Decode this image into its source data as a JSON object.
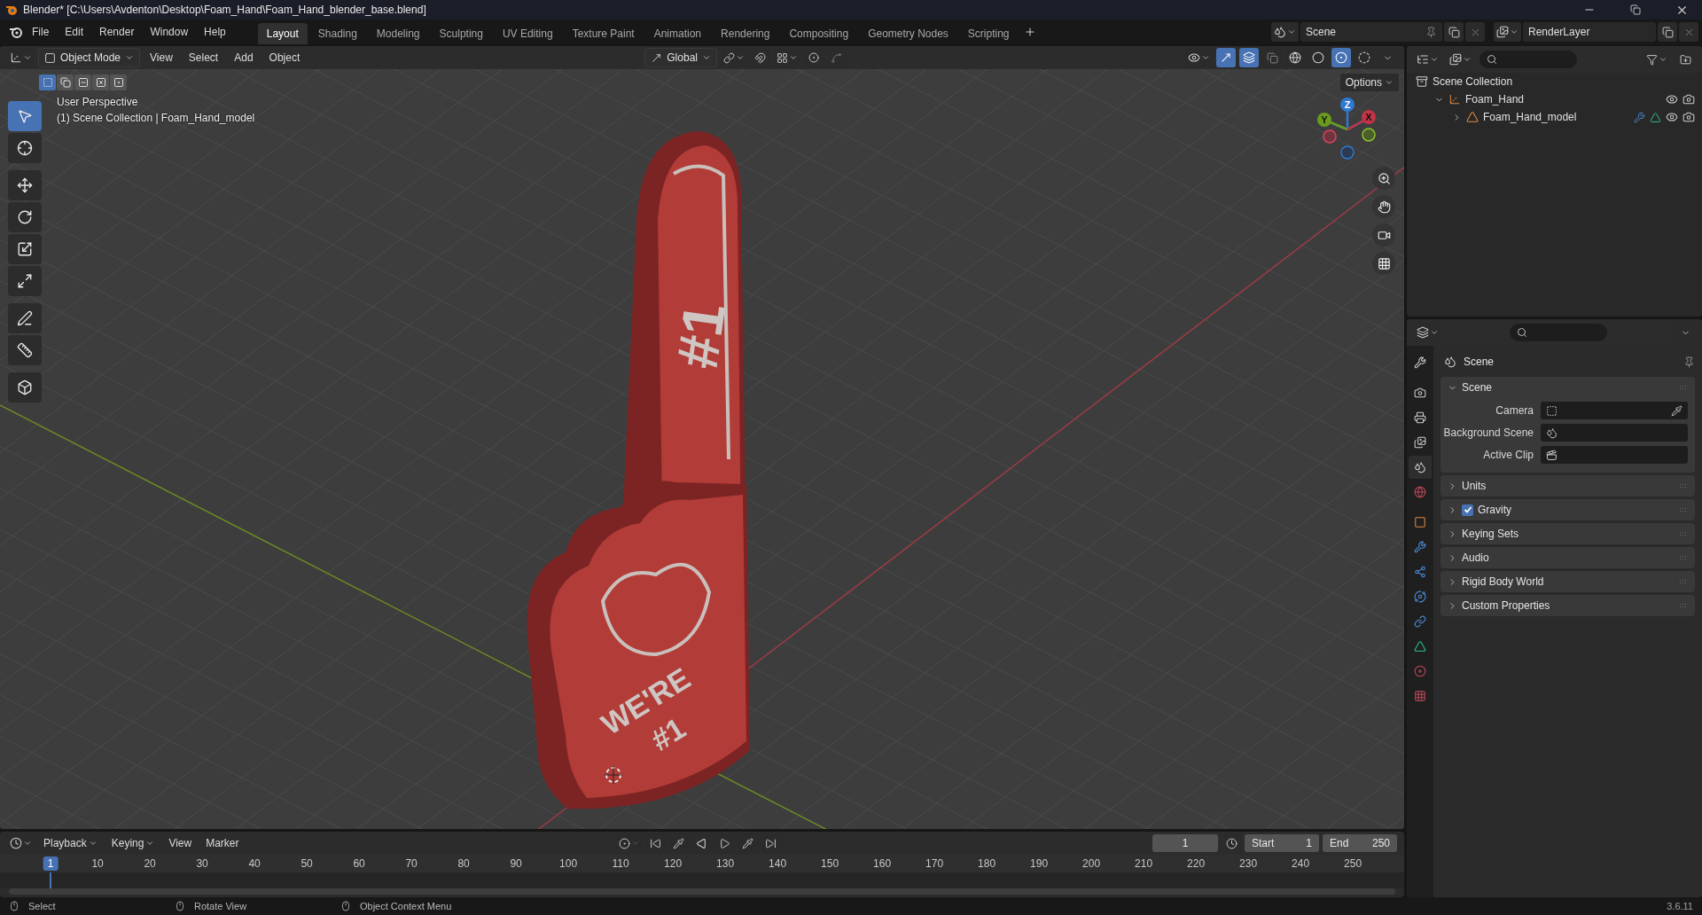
{
  "window": {
    "title": "Blender* [C:\\Users\\Avdenton\\Desktop\\Foam_Hand\\Foam_Hand_blender_base.blend]"
  },
  "menu": [
    "File",
    "Edit",
    "Render",
    "Window",
    "Help"
  ],
  "workspaces": [
    {
      "label": "Layout",
      "selected": true
    },
    {
      "label": "Shading",
      "selected": false
    },
    {
      "label": "Modeling",
      "selected": false
    },
    {
      "label": "Sculpting",
      "selected": false
    },
    {
      "label": "UV Editing",
      "selected": false
    },
    {
      "label": "Texture Paint",
      "selected": false
    },
    {
      "label": "Animation",
      "selected": false
    },
    {
      "label": "Rendering",
      "selected": false
    },
    {
      "label": "Compositing",
      "selected": false
    },
    {
      "label": "Geometry Nodes",
      "selected": false
    },
    {
      "label": "Scripting",
      "selected": false
    }
  ],
  "scene": {
    "value": "Scene"
  },
  "view_layer": {
    "value": "RenderLayer"
  },
  "viewport": {
    "mode": "Object Mode",
    "menus": [
      "View",
      "Select",
      "Add",
      "Object"
    ],
    "orientation": "Global",
    "options": "Options",
    "info": [
      "User Perspective",
      "(1) Scene Collection | Foam_Hand_model"
    ],
    "select_modes": [
      {
        "kind": "set",
        "selected": true
      },
      {
        "kind": "extend",
        "selected": false
      },
      {
        "kind": "subtract",
        "selected": false
      },
      {
        "kind": "difference",
        "selected": false
      },
      {
        "kind": "intersect",
        "selected": false
      }
    ],
    "tools": [
      {
        "kind": "select",
        "selected": true
      },
      {
        "kind": "cursor",
        "selected": false
      },
      {
        "kind": "move",
        "selected": false
      },
      {
        "kind": "rotate",
        "selected": false
      },
      {
        "kind": "scale",
        "selected": false
      },
      {
        "kind": "transform",
        "selected": false
      },
      {
        "kind": "annotate",
        "selected": false
      },
      {
        "kind": "measure",
        "selected": false
      },
      {
        "kind": "add-cube",
        "selected": false
      }
    ],
    "gizmo_labels": [
      "Z",
      "Y",
      "X"
    ],
    "shading_modes": [
      {
        "kind": "wireframe",
        "selected": false
      },
      {
        "kind": "solid",
        "selected": false
      },
      {
        "kind": "material",
        "selected": true
      },
      {
        "kind": "rendered",
        "selected": false
      }
    ],
    "decal_texts": [
      "#1",
      "WE'RE",
      "#1"
    ]
  },
  "outliner": {
    "items": [
      {
        "label": "Scene Collection",
        "kind": "collection",
        "children": [
          {
            "label": "Foam_Hand",
            "kind": "empty",
            "expanded": true,
            "children": [
              {
                "label": "Foam_Hand_model",
                "kind": "mesh",
                "expanded": false
              }
            ]
          }
        ]
      }
    ]
  },
  "properties": {
    "context": "Scene",
    "tabs": [
      {
        "kind": "tool",
        "selected": false
      },
      {
        "kind": "render",
        "selected": false
      },
      {
        "kind": "output",
        "selected": false
      },
      {
        "kind": "view-layer",
        "selected": false
      },
      {
        "kind": "scene",
        "selected": true
      },
      {
        "kind": "world",
        "selected": false
      },
      {
        "kind": "object",
        "selected": false
      },
      {
        "kind": "modifiers",
        "selected": false
      },
      {
        "kind": "particles",
        "selected": false
      },
      {
        "kind": "physics",
        "selected": false
      },
      {
        "kind": "constraints",
        "selected": false
      },
      {
        "kind": "data",
        "selected": false
      },
      {
        "kind": "material",
        "selected": false
      },
      {
        "kind": "texture",
        "selected": false
      }
    ],
    "panels": [
      {
        "title": "Scene",
        "expanded": true,
        "fields": [
          {
            "label": "Camera",
            "kind": "camera"
          },
          {
            "label": "Background Scene",
            "kind": "scene"
          },
          {
            "label": "Active Clip",
            "kind": "clip"
          }
        ]
      },
      {
        "title": "Units",
        "expanded": false
      },
      {
        "title": "Gravity",
        "expanded": false,
        "checked": true
      },
      {
        "title": "Keying Sets",
        "expanded": false
      },
      {
        "title": "Audio",
        "expanded": false
      },
      {
        "title": "Rigid Body World",
        "expanded": false
      },
      {
        "title": "Custom Properties",
        "expanded": false
      }
    ]
  },
  "timeline": {
    "menus": [
      {
        "label": "Playback",
        "dropdown": true
      },
      {
        "label": "Keying",
        "dropdown": true
      },
      {
        "label": "View",
        "dropdown": false
      },
      {
        "label": "Marker",
        "dropdown": false
      }
    ],
    "frame_field": "1",
    "start_label": "Start",
    "start": "1",
    "end_label": "End",
    "end": "250",
    "playhead": "1",
    "ruler": [
      "10",
      "20",
      "30",
      "40",
      "50",
      "60",
      "70",
      "80",
      "90",
      "100",
      "110",
      "120",
      "130",
      "140",
      "150",
      "160",
      "170",
      "180",
      "190",
      "200",
      "210",
      "220",
      "230",
      "240",
      "250"
    ]
  },
  "status_bar": {
    "hints": [
      "Select",
      "Rotate View",
      "Object Context Menu"
    ],
    "version": "3.6.11"
  }
}
